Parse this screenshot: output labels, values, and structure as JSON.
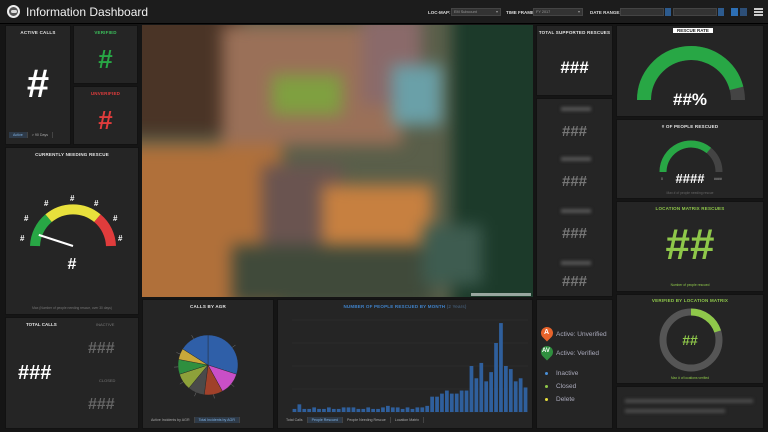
{
  "header": {
    "title": "Information Dashboard",
    "loc_map_label": "LOC-MAP:",
    "loc_map_value": "EM Subcount",
    "time_frame_label": "TIME FRAME:",
    "time_frame_value": "FY 2017",
    "date_range_label": "DATE RANGE:"
  },
  "left": {
    "active_calls": {
      "title": "ACTIVE CALLS",
      "value": "#",
      "tab_active": "Active",
      "tab_other": "> 90 Days"
    },
    "verified": {
      "title": "VERIFIED",
      "value": "#"
    },
    "unverified": {
      "title": "UNVERIFIED",
      "value": "#"
    },
    "needing_rescue": {
      "title": "CURRENTLY NEEDING RESCUE",
      "ticks": [
        "#",
        "#",
        "#",
        "#",
        "#",
        "#",
        "#"
      ],
      "value": "#",
      "footer": "Max (Number of people needing rescue, over 30 days)",
      "level": 0.1
    },
    "total_calls": {
      "title": "TOTAL CALLS",
      "value": "###",
      "inactive_label": "INACTIVE",
      "inactive_value": "###",
      "closed_label": "CLOSED",
      "closed_value": "###"
    }
  },
  "right_col1": {
    "title": "TOTAL SUPPORTED RESCUES",
    "value": "###",
    "items": [
      "###",
      "###",
      "###",
      "###"
    ]
  },
  "right_col2": {
    "rescue_rate": {
      "title": "RESCUE RATE",
      "value": "##%",
      "level": 0.92
    },
    "people_rescued": {
      "title": "# OF PEOPLE RESCUED",
      "value": "####",
      "min": "0",
      "max": "####",
      "footer": "Max # of people needing rescue",
      "level": 0.72
    },
    "location_rescues": {
      "title": "LOCATION MATRIX RESCUES",
      "value": "##",
      "footer": "Number of people rescued"
    },
    "verified_matrix": {
      "title": "VERIFIED BY LOCATION MATRIX",
      "value": "##",
      "footer": "Max # of locations verified",
      "level": 0.2
    }
  },
  "calls_by_agr": {
    "title": "CALLS BY AGR",
    "tab1": "Active Incidents by AGR",
    "tab2": "Total Incidents by AGR"
  },
  "people_by_month": {
    "title": "NUMBER OF PEOPLE RESCUED BY MONTH",
    "title_suffix": "(2 Years)",
    "tabs": [
      "Total Calls",
      "People Rescued",
      "People Needing Rescue",
      "Location Matrix"
    ]
  },
  "legend": {
    "a_label": "Active: Unverified",
    "a_letter": "A",
    "av_label": "Active: Verified",
    "av_letter": "AV",
    "inactive": "Inactive",
    "closed": "Closed",
    "delete": "Delete"
  },
  "colors": {
    "green": "#28a745",
    "red": "#e03c3c",
    "yellow": "#e8e03c",
    "lime": "#8fc84a",
    "bar_blue": "#2f5f9c",
    "orange": "#e6632b",
    "dark_green": "#2f8f3f"
  },
  "chart_data": [
    {
      "type": "pie",
      "title": "CALLS BY AGR",
      "values": [
        30,
        12,
        10,
        9,
        9,
        8,
        6,
        16
      ],
      "colors": [
        "#2f5fa8",
        "#c94fc7",
        "#a0412a",
        "#4a4a4a",
        "#8da13a",
        "#2f8f3f",
        "#c8a83a",
        "#2f5fa8"
      ]
    },
    {
      "type": "bar",
      "title": "NUMBER OF PEOPLE RESCUED BY MONTH",
      "values": [
        2,
        5,
        2,
        2,
        3,
        2,
        2,
        3,
        2,
        2,
        3,
        3,
        3,
        2,
        2,
        3,
        2,
        2,
        3,
        4,
        3,
        3,
        2,
        3,
        2,
        3,
        3,
        4,
        10,
        10,
        12,
        14,
        12,
        12,
        14,
        14,
        30,
        22,
        32,
        20,
        26,
        45,
        58,
        30,
        28,
        20,
        22,
        16
      ],
      "ylim": [
        0,
        60
      ]
    }
  ]
}
